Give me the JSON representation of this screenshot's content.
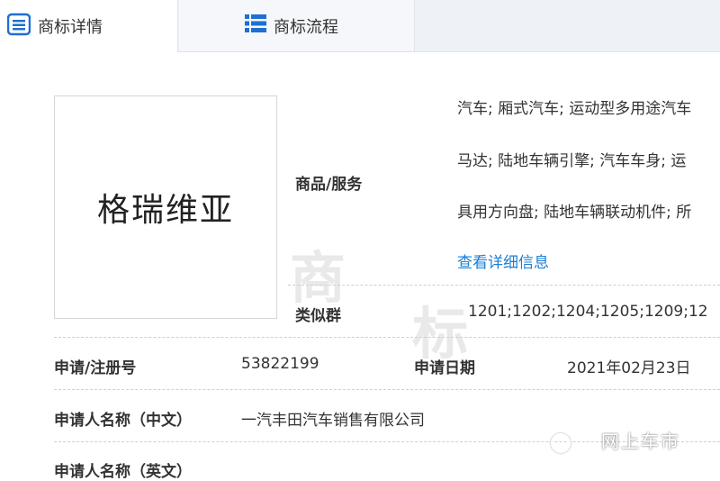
{
  "tabs": [
    {
      "label": "商标详情",
      "icon": "document-list-icon",
      "active": true
    },
    {
      "label": "商标流程",
      "icon": "bulleted-list-icon",
      "active": false
    }
  ],
  "trademark": {
    "logo_text": "格瑞维亚"
  },
  "goods_services": {
    "label": "商品/服务",
    "lines": [
      "汽车; 厢式汽车; 运动型多用途汽车",
      "马达; 陆地车辆引擎; 汽车车身; 运",
      "具用方向盘; 陆地车辆联动机件; 所"
    ],
    "detail_link": "查看详细信息"
  },
  "similar_group": {
    "label": "类似群",
    "value": "1201;1202;1204;1205;1209;12"
  },
  "registration": {
    "label": "申请/注册号",
    "value": "53822199"
  },
  "application_date": {
    "label": "申请日期",
    "value": "2021年02月23日"
  },
  "applicant_cn": {
    "label": "申请人名称（中文）",
    "value": "一汽丰田汽车销售有限公司"
  },
  "applicant_en": {
    "label": "申请人名称（英文）",
    "value": ""
  },
  "watermark": {
    "chars": [
      "商",
      "标"
    ],
    "brand": "网上车市"
  },
  "colors": {
    "link": "#1a7fd4",
    "tab_icon": "#1f6fd1",
    "tab_bar": "#eef1f5"
  }
}
